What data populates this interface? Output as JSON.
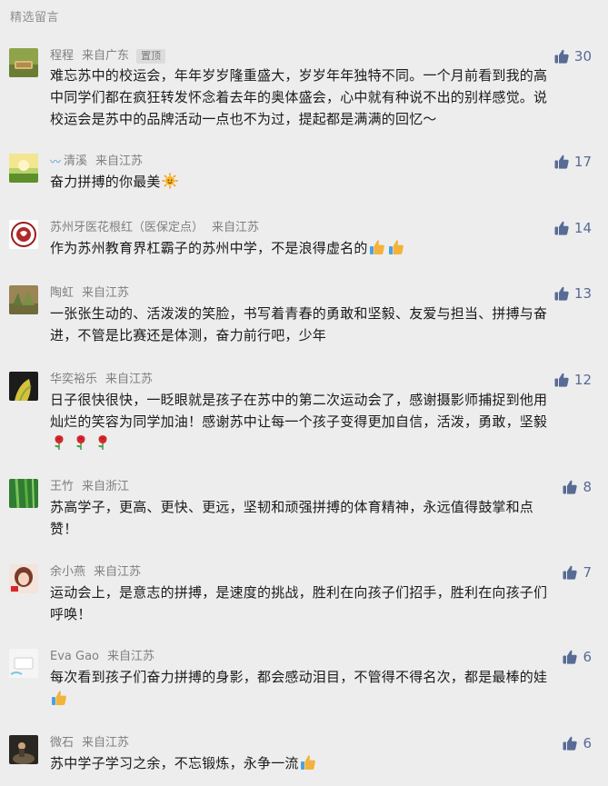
{
  "section_title": "精选留言",
  "comments": [
    {
      "name": "程程",
      "from": "来自广东",
      "pinned": "置顶",
      "likes": "30",
      "content": "难忘苏中的校运会，年年岁岁隆重盛大，岁岁年年独特不同。一个月前看到我的高\n中同学们都在疯狂转发怀念着去年的奥体盛会，心中就有种说不出的别样感觉。说\n校运会是苏中的品牌活动一点也不为过，提起都是满满的回忆～",
      "emojis": []
    },
    {
      "name": "清溪",
      "from": "来自江苏",
      "likes": "17",
      "content": "奋力拼搏的你最美",
      "emojis": [
        "sun"
      ]
    },
    {
      "name": "苏州牙医花根红（医保定点）",
      "from": "来自江苏",
      "likes": "14",
      "content": "作为苏州教育界杠霸子的苏州中学，不是浪得虚名的",
      "emojis": [
        "thumb",
        "thumb"
      ]
    },
    {
      "name": "陶虹",
      "from": "来自江苏",
      "likes": "13",
      "content": "一张张生动的、活泼泼的笑脸，书写着青春的勇敢和坚毅、友爱与担当、拼搏与奋\n进，不管是比赛还是体测，奋力前行吧，少年",
      "emojis": []
    },
    {
      "name": "华奕裕乐",
      "from": "来自江苏",
      "likes": "12",
      "content": "日子很快很快，一眨眼就是孩子在苏中的第二次运动会了，感谢摄影师捕捉到他用\n灿烂的笑容为同学加油！感谢苏中让每一个孩子变得更加自信，活泼，勇敢，坚毅\n",
      "emojis": [
        "rose",
        "rose",
        "rose"
      ]
    },
    {
      "name": "王竹",
      "from": "来自浙江",
      "likes": "8",
      "content": "苏高学子，更高、更快、更远，坚韧和顽强拼搏的体育精神，永远值得鼓掌和点\n赞！",
      "emojis": []
    },
    {
      "name": "余小燕",
      "from": "来自江苏",
      "likes": "7",
      "content": "运动会上，是意志的拼搏，是速度的挑战，胜利在向孩子们招手，胜利在向孩子们\n呼唤！",
      "emojis": []
    },
    {
      "name": "Eva Gao",
      "from": "来自江苏",
      "likes": "6",
      "content": "每次看到孩子们奋力拼搏的身影，都会感动泪目，不管得不得名次，都是最棒的娃\n",
      "emojis": [
        "thumb"
      ]
    },
    {
      "name": "微石",
      "from": "来自江苏",
      "likes": "6",
      "content": "苏中学子学习之余，不忘锻炼，永争一流",
      "emojis": [
        "thumb"
      ]
    }
  ]
}
